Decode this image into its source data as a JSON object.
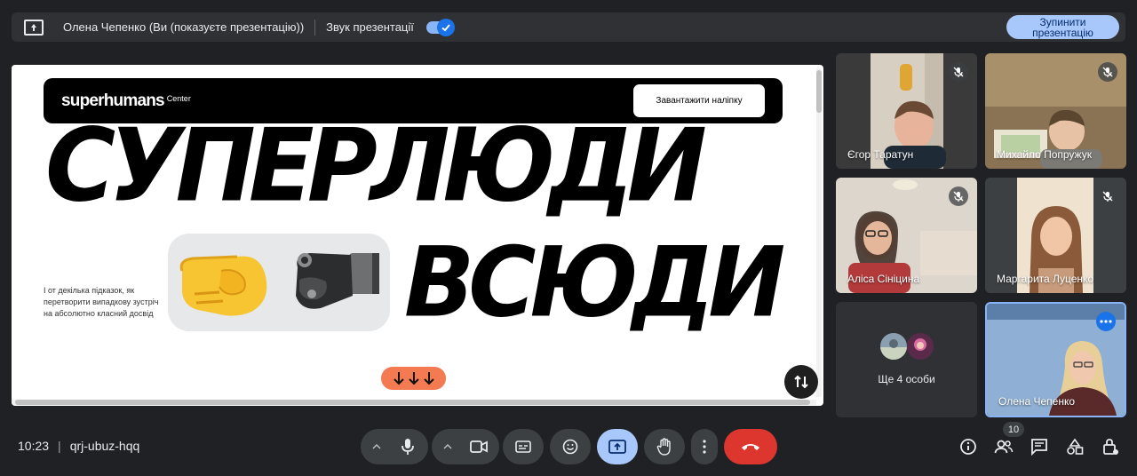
{
  "topbar": {
    "presenter_text": "Олена Чепенко (Ви (показуєте презентацію))",
    "sound_label": "Звук презентації",
    "sound_enabled": true,
    "stop_button": "Зупинити презентацію"
  },
  "slide": {
    "logo": "superhumans",
    "logo_sub": "Center",
    "download_button": "Завантажити наліпку",
    "headline_line1": "СУПЕРЛЮДИ",
    "headline_line2": "ВСЮДИ",
    "subtext": "І от декілька підказок, як перетворити випадкову зустріч на абсолютно класний досвід",
    "arrows": "↓↓↓"
  },
  "participants": [
    {
      "name": "Єгор Таратун",
      "muted": true
    },
    {
      "name": "Михайло Попружук",
      "muted": true
    },
    {
      "name": "Аліса Сініцина",
      "muted": true
    },
    {
      "name": "Маргарита Луценко",
      "muted": true
    },
    {
      "name": "Ще 4 особи"
    },
    {
      "name": "Олена Чепенко",
      "self": true
    }
  ],
  "bottom": {
    "time": "10:23",
    "meeting_code": "qrj-ubuz-hqq",
    "participant_count": "10"
  },
  "colors": {
    "background": "#202124",
    "hangup": "#dc362e",
    "active_control": "#a8c7fa",
    "accent": "#1a73e8",
    "slide_arrow_pill": "#f47a52"
  }
}
